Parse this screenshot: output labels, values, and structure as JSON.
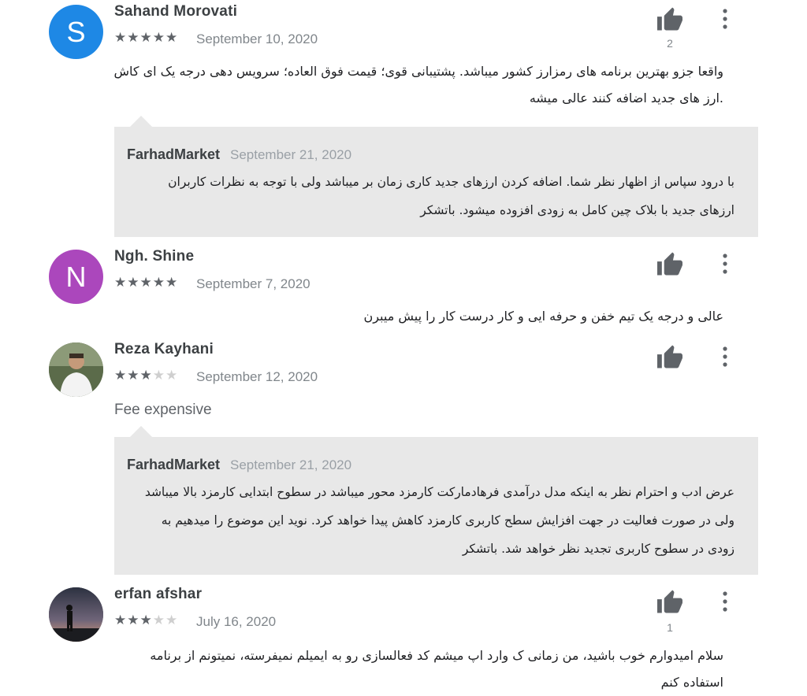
{
  "reviews": [
    {
      "avatar_letter": "S",
      "avatar_color": "#1e88e5",
      "name": "Sahand Morovati",
      "rating": 5,
      "date": "September 10, 2020",
      "likes": "2",
      "text_lines": [
        "واقعا جزو بهترین برنامه های رمزارز کشور میباشد. پشتیبانی قوی؛ قیمت فوق العاده؛ سرویس دهی درجه یک ای کاش",
        ".ارز های جدید اضافه کنند عالی میشه"
      ],
      "reply": {
        "author": "FarhadMarket",
        "date": "September 21, 2020",
        "lines": [
          "با درود سپاس از اظهار نظر شما. اضافه کردن ارزهای جدید کاری زمان بر میباشد ولی با توجه به نظرات کاربران",
          "ارزهای جدید با بلاک چین کامل به زودی افزوده میشود. باتشکر"
        ]
      }
    },
    {
      "avatar_letter": "N",
      "avatar_color": "#ab47bc",
      "name": "Ngh. Shine",
      "rating": 5,
      "date": "September 7, 2020",
      "likes": "",
      "text_lines": [
        "عالی و درجه یک تیم خفن و حرفه ایی و کار درست کار را پیش میبرن"
      ]
    },
    {
      "avatar_letter": "",
      "avatar_color": "#7d8a6e",
      "name": "Reza Kayhani",
      "rating": 3,
      "date": "September 12, 2020",
      "likes": "",
      "text_en": "Fee expensive",
      "reply": {
        "author": "FarhadMarket",
        "date": "September 21, 2020",
        "lines": [
          "عرض ادب و احترام نظر به اینکه مدل درآمدی فرهادمارکت کارمزد محور میباشد در سطوح ابتدایی کارمزد بالا میباشد",
          "ولی در صورت فعالیت در جهت افزایش سطح کاربری کارمزد کاهش پیدا خواهد کرد. نوید این موضوع را میدهیم به",
          "زودی در سطوح کاربری تجدید نظر خواهد شد. باتشکر"
        ]
      }
    },
    {
      "avatar_letter": "",
      "avatar_color": "#3a3f4a",
      "name": "erfan afshar",
      "rating": 3,
      "date": "July 16, 2020",
      "likes": "1",
      "text_lines": [
        "سلام امیدوارم خوب باشید، من زمانی ک وارد اپ میشم کد فعالسازی رو به ایمیلم نمیفرسته، نمیتونم از برنامه استفاده کنم"
      ]
    }
  ],
  "icons": {
    "thumb": "thumbs-up-icon",
    "more": "more-vert-icon",
    "star": "star-icon"
  }
}
